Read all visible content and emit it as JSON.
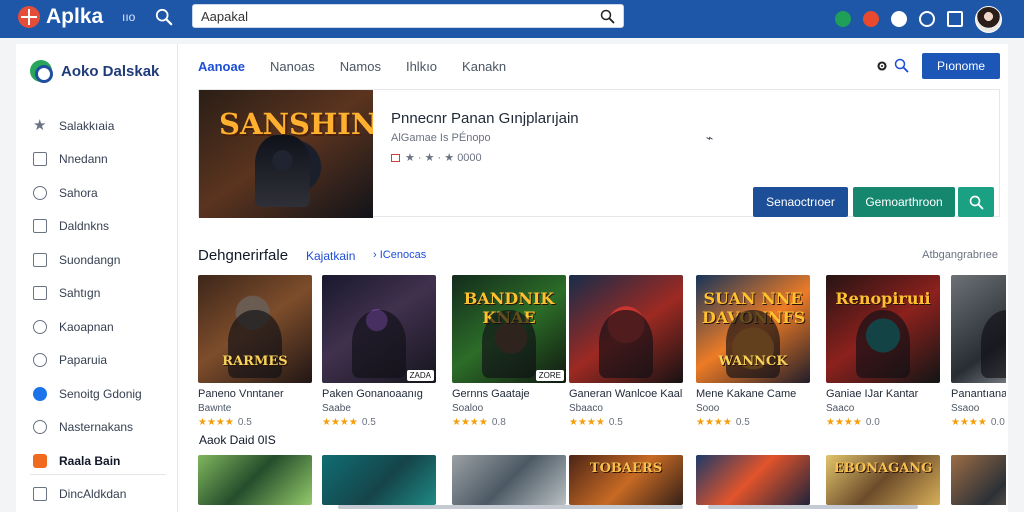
{
  "header": {
    "logo_text": "Aplka",
    "small_text": "ııo",
    "search_value": "Aapakal",
    "colors": {
      "bar": "#1e56a8",
      "accent": "#e44d3a"
    },
    "icons": [
      "grid-icon",
      "red-app-icon",
      "white-circle-icon",
      "account-circle-icon",
      "window-icon"
    ]
  },
  "sidebar": {
    "brand": "Aoko Dalskak",
    "items": [
      {
        "label": "Salakkıaia",
        "icon": "star-icon"
      },
      {
        "label": "Nnedann",
        "icon": "message-icon"
      },
      {
        "label": "Sahora",
        "icon": "info-icon"
      },
      {
        "label": "Daldnkns",
        "icon": "warning-icon"
      },
      {
        "label": "Suondangn",
        "icon": "box-icon"
      },
      {
        "label": "Sahtıgn",
        "icon": "box-icon"
      },
      {
        "label": "Kaoapnan",
        "icon": "gear-icon"
      },
      {
        "label": "Paparuia",
        "icon": "shield-icon"
      },
      {
        "label": "Senoitg Gdonig",
        "icon": "verified-icon"
      },
      {
        "label": "Nasternakans",
        "icon": "chat-icon"
      },
      {
        "label": "Raala Bain",
        "icon": "orange-puzzle-icon"
      },
      {
        "label": "DincAldkdan",
        "icon": "box-icon"
      }
    ]
  },
  "main": {
    "tabs": [
      "Aanoae",
      "Nanoas",
      "Namos",
      "Ihlkıo",
      "Kanakn"
    ],
    "premium_label": "Pıonome",
    "hero": {
      "cover_text": "SANSHIN",
      "title": "Pnnecnr Panan Gınjplarıjain",
      "meta_line1": "AlGamae Is PÉnopo",
      "meta_line2": "★ · ★ · ★ 0000",
      "primary_button": "Senaoctrıoer",
      "secondary_button": "Gemoarthroon"
    },
    "section": {
      "title": "Dehgnerirfale",
      "link": "Kajatkain",
      "crumb": "› ICenocas",
      "right_label": "Atbgangrabrıee"
    },
    "cards": [
      {
        "name": "Paneno Vnntaner",
        "meta": "Bawnte",
        "rating_value": "0.5",
        "cover_top": "",
        "cover_bottom": "RARMES",
        "badge": ""
      },
      {
        "name": "Paken Gonanoaanıg",
        "meta": "Saabe",
        "rating_value": "0.5",
        "cover_top": "",
        "cover_bottom": "",
        "badge": "ZADA"
      },
      {
        "name": "Gernns Gaataje",
        "meta": "Soaloo",
        "rating_value": "0.8",
        "cover_top": "BANDNIK KNAE",
        "cover_bottom": "",
        "badge": "ZORE"
      },
      {
        "name": "Ganeran Wanlcoe Kaal",
        "meta": "Sbaaco",
        "rating_value": "0.5",
        "cover_top": "",
        "cover_bottom": "",
        "badge": ""
      },
      {
        "name": "Mene Kakane Came",
        "meta": "Sooo",
        "rating_value": "0.5",
        "cover_top": "SUAN NNE DAVONNFS",
        "cover_bottom": "WANNCK",
        "badge": ""
      },
      {
        "name": "Ganiae IJar Kantar",
        "meta": "Saaco",
        "rating_value": "0.0",
        "cover_top": "Renopiruıi",
        "cover_bottom": "",
        "badge": ""
      },
      {
        "name": "Panantıana",
        "meta": "Ssaoo",
        "rating_value": "0.0",
        "cover_top": "",
        "cover_bottom": "",
        "badge": ""
      }
    ],
    "section2_title": "Aaok Daid 0IS",
    "bottom_tiles": [
      {
        "text": ""
      },
      {
        "text": ""
      },
      {
        "text": ""
      },
      {
        "text": "TOBAERS"
      },
      {
        "text": ""
      },
      {
        "text": "EBONAGANG"
      },
      {
        "text": ""
      }
    ]
  }
}
